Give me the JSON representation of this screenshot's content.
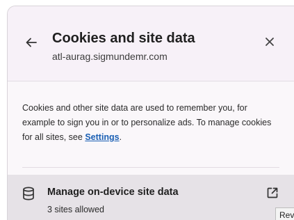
{
  "header": {
    "title": "Cookies and site data",
    "site": "atl-aurag.sigmundemr.com"
  },
  "description": {
    "text_before_link": "Cookies and other site data are used to remember you, for example to sign you in or to personalize ads. To manage cookies for all sites, see ",
    "link_label": "Settings",
    "text_after_link": "."
  },
  "manage": {
    "label": "Manage on-device site data",
    "status": "3 sites allowed"
  },
  "tooltip": {
    "text": "Rev"
  },
  "icons": {
    "back": "arrow-back-icon",
    "close": "close-icon",
    "storage": "database-icon",
    "open": "open-in-new-icon"
  },
  "colors": {
    "link": "#1a5fb4",
    "header_bg": "#f7f1f8",
    "row_bg": "#e6e2e7"
  }
}
